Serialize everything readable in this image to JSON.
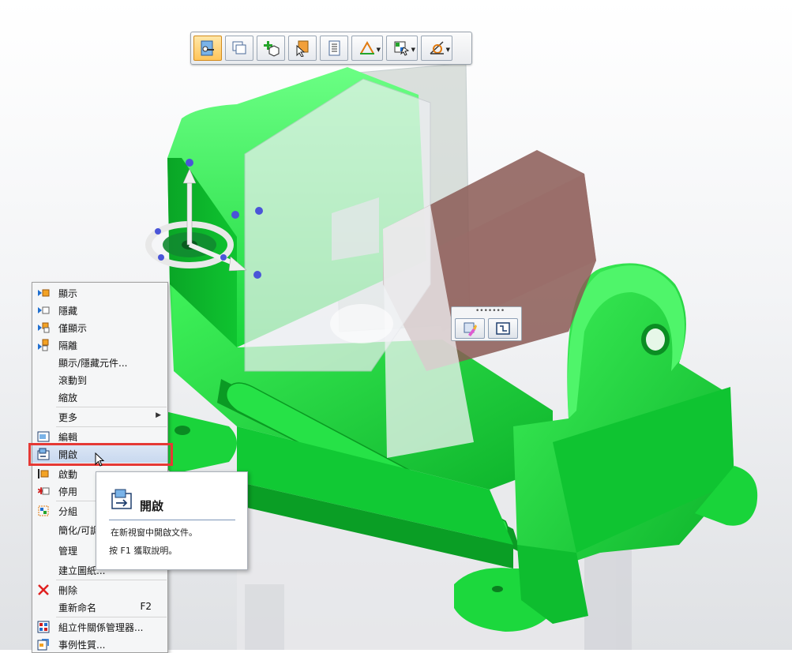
{
  "toolbar": {
    "buttons": [
      {
        "icon": "select-tool-icon",
        "active": true
      },
      {
        "icon": "window-copy-icon"
      },
      {
        "icon": "add-part-icon"
      },
      {
        "icon": "part-select-cursor-icon"
      },
      {
        "icon": "list-document-icon"
      },
      {
        "icon": "sketch-triangle-icon",
        "dropdown": true
      },
      {
        "icon": "grid-layout-icon",
        "dropdown": true
      },
      {
        "icon": "measure-angle-icon",
        "dropdown": true
      }
    ]
  },
  "minibar": {
    "grip": "•••••••",
    "buttons": [
      {
        "icon": "paint-brush-icon"
      },
      {
        "icon": "frame-open-icon"
      }
    ]
  },
  "context_menu": {
    "items": [
      {
        "label": "顯示",
        "icon": "show-icon"
      },
      {
        "label": "隱藏",
        "icon": "hide-icon"
      },
      {
        "label": "僅顯示",
        "icon": "show-only-icon"
      },
      {
        "label": "隔離",
        "icon": "isolate-icon"
      },
      {
        "label": "顯示/隱藏元件...",
        "icon": ""
      },
      {
        "label": "滾動到",
        "icon": ""
      },
      {
        "label": "縮放",
        "icon": ""
      },
      {
        "label": "更多",
        "icon": "",
        "submenu": "▶"
      },
      {
        "label": "編輯",
        "icon": "edit-icon"
      },
      {
        "label": "開啟",
        "icon": "open-document-icon"
      },
      {
        "label": "啟動",
        "icon": "activate-icon"
      },
      {
        "label": "停用",
        "icon": "deactivate-icon"
      },
      {
        "label": "分組",
        "icon": "group-icon"
      },
      {
        "label": "簡化/可調",
        "icon": ""
      },
      {
        "label": "管理",
        "icon": ""
      },
      {
        "label": "建立圖紙...",
        "icon": ""
      },
      {
        "label": "刪除",
        "icon": "delete-x-icon"
      },
      {
        "label": "重新命名",
        "icon": "",
        "shortcut": "F2"
      },
      {
        "label": "組立件關係管理器...",
        "icon": "relationship-manager-icon"
      },
      {
        "label": "事例性質...",
        "icon": "properties-icon"
      }
    ]
  },
  "tooltip": {
    "title": "開啟",
    "description": "在新視窗中開啟文件。",
    "help": "按 F1 獲取說明。",
    "icon": "open-document-icon"
  },
  "colors": {
    "part_green": "#12d23a",
    "highlight_red": "#e53935",
    "menu_highlight": "#c8d8ef"
  }
}
